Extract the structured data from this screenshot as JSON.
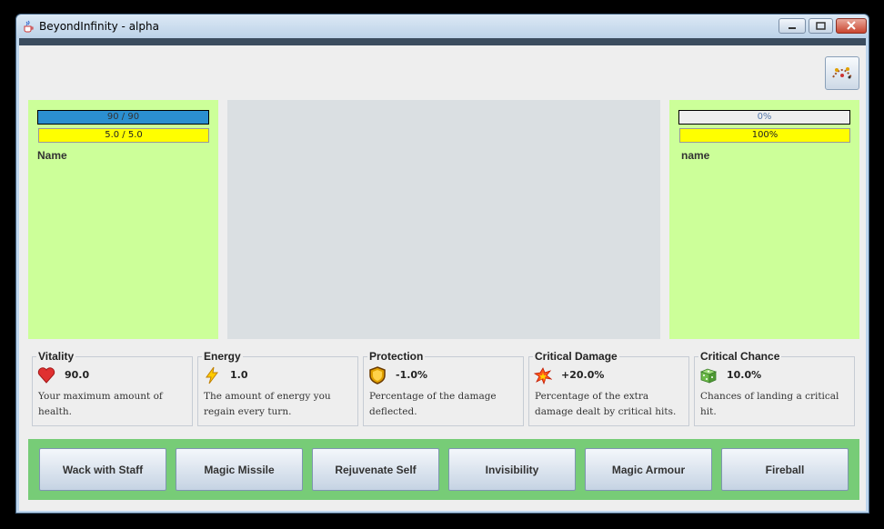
{
  "window": {
    "title": "BeyondInfinity - alpha"
  },
  "player": {
    "health_text": "90 / 90",
    "health_fraction": 1.0,
    "energy_text": "5.0 / 5.0",
    "energy_fraction": 1.0,
    "name": "Name"
  },
  "enemy": {
    "health_text": "0%",
    "health_fraction": 0.0,
    "energy_text": "100%",
    "energy_fraction": 1.0,
    "name": "name"
  },
  "stats": [
    {
      "title": "Vitality",
      "icon": "heart-icon",
      "value": "90.0",
      "desc": "Your maximum amount of health."
    },
    {
      "title": "Energy",
      "icon": "lightning-icon",
      "value": "1.0",
      "desc": "The amount of energy you regain every turn."
    },
    {
      "title": "Protection",
      "icon": "shield-icon",
      "value": "-1.0%",
      "desc": "Percentage of the damage deflected."
    },
    {
      "title": "Critical Damage",
      "icon": "explosion-icon",
      "value": "+20.0%",
      "desc": "Percentage of the extra damage dealt by critical hits."
    },
    {
      "title": "Critical Chance",
      "icon": "dice-icon",
      "value": "10.0%",
      "desc": "Chances of landing a critical hit."
    }
  ],
  "actions": [
    "Wack with Staff",
    "Magic Missile",
    "Rejuvenate Self",
    "Invisibility",
    "Magic Armour",
    "Fireball"
  ],
  "colors": {
    "panel": "#ccff99",
    "actions_bg": "#77cc77",
    "health_fill": "#2b8fd0",
    "energy_fill": "#ffff00"
  }
}
